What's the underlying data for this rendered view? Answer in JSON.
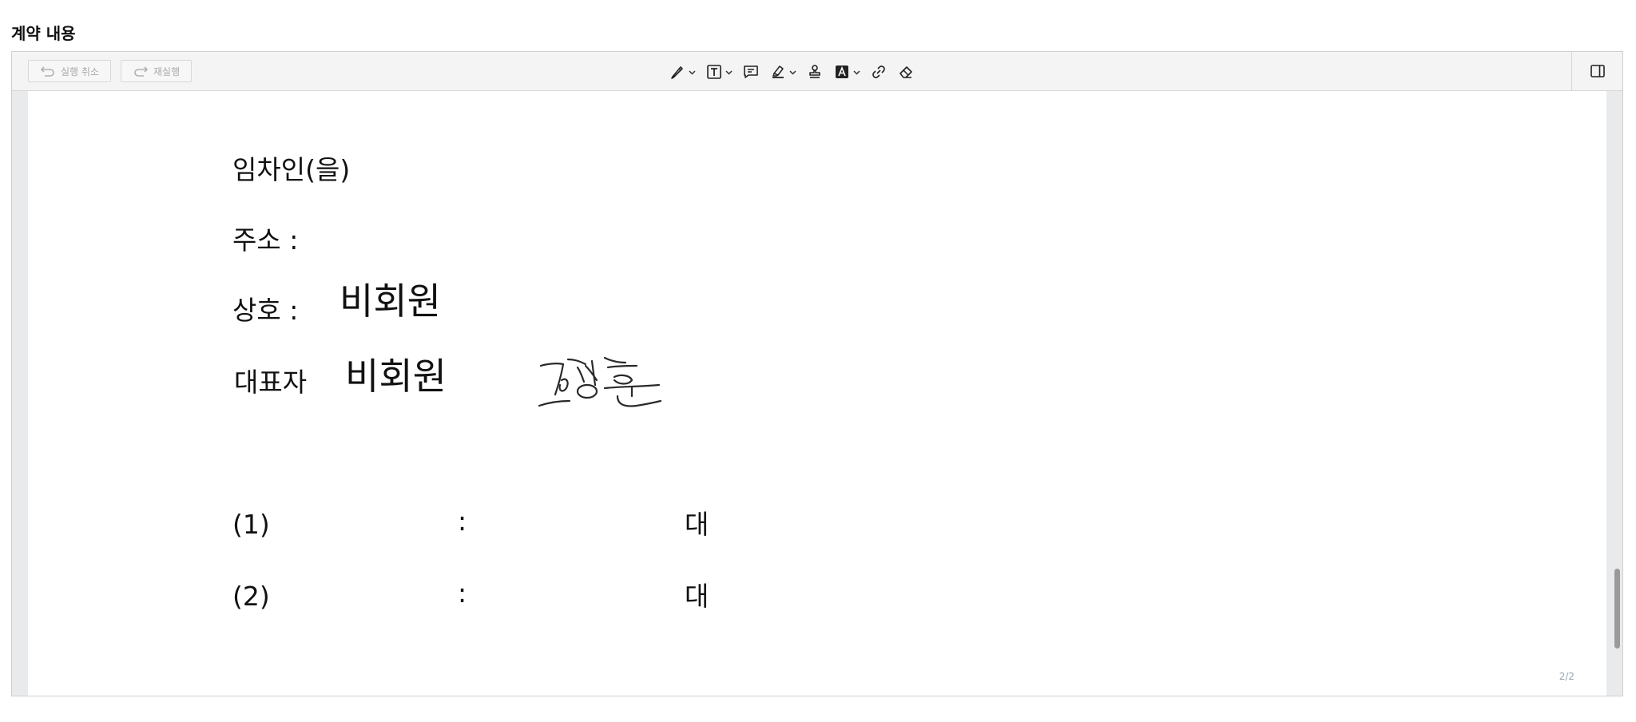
{
  "section": {
    "title": "계약 내용"
  },
  "toolbar": {
    "undo_label": "실행 취소",
    "redo_label": "재실행",
    "tools": [
      {
        "icon": "pen-icon",
        "has_dropdown": true
      },
      {
        "icon": "text-box-icon",
        "has_dropdown": true
      },
      {
        "icon": "comment-icon",
        "has_dropdown": false
      },
      {
        "icon": "highlighter-icon",
        "has_dropdown": true
      },
      {
        "icon": "stamp-icon",
        "has_dropdown": false
      },
      {
        "icon": "text-color-icon",
        "has_dropdown": true
      },
      {
        "icon": "link-icon",
        "has_dropdown": false
      },
      {
        "icon": "eraser-icon",
        "has_dropdown": false
      }
    ]
  },
  "document": {
    "tenant_heading": "임차인(을)",
    "address_label": "주소 :",
    "company_label": "상호 :",
    "company_value": "비회원",
    "representative_label": "대표자",
    "representative_value": "비회원",
    "signature_text": "고상훈",
    "items": [
      {
        "number": "(1)",
        "colon": ":",
        "suffix": "대"
      },
      {
        "number": "(2)",
        "colon": ":",
        "suffix": "대"
      }
    ],
    "page_indicator": "2/2"
  }
}
